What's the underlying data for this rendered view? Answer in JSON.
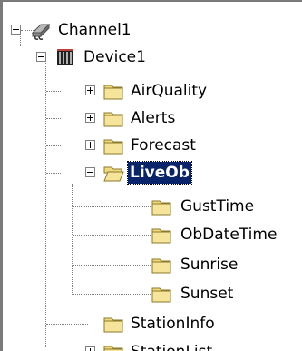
{
  "tree": {
    "channel": {
      "label": "Channel1"
    },
    "device": {
      "label": "Device1"
    },
    "folders": [
      {
        "label": "AirQuality",
        "state": "collapsed"
      },
      {
        "label": "Alerts",
        "state": "collapsed"
      },
      {
        "label": "Forecast",
        "state": "collapsed"
      },
      {
        "label": "LiveOb",
        "state": "expanded",
        "selected": true
      },
      {
        "label": "GustTime",
        "state": "leaf"
      },
      {
        "label": "ObDateTime",
        "state": "leaf"
      },
      {
        "label": "Sunrise",
        "state": "leaf"
      },
      {
        "label": "Sunset",
        "state": "leaf"
      },
      {
        "label": "StationInfo",
        "state": "leaf"
      },
      {
        "label": "StationList",
        "state": "collapsed"
      }
    ]
  },
  "colors": {
    "selection_bg": "#0a246a",
    "folder_fill": "#f0d97a",
    "folder_edge": "#8a7a2a"
  }
}
